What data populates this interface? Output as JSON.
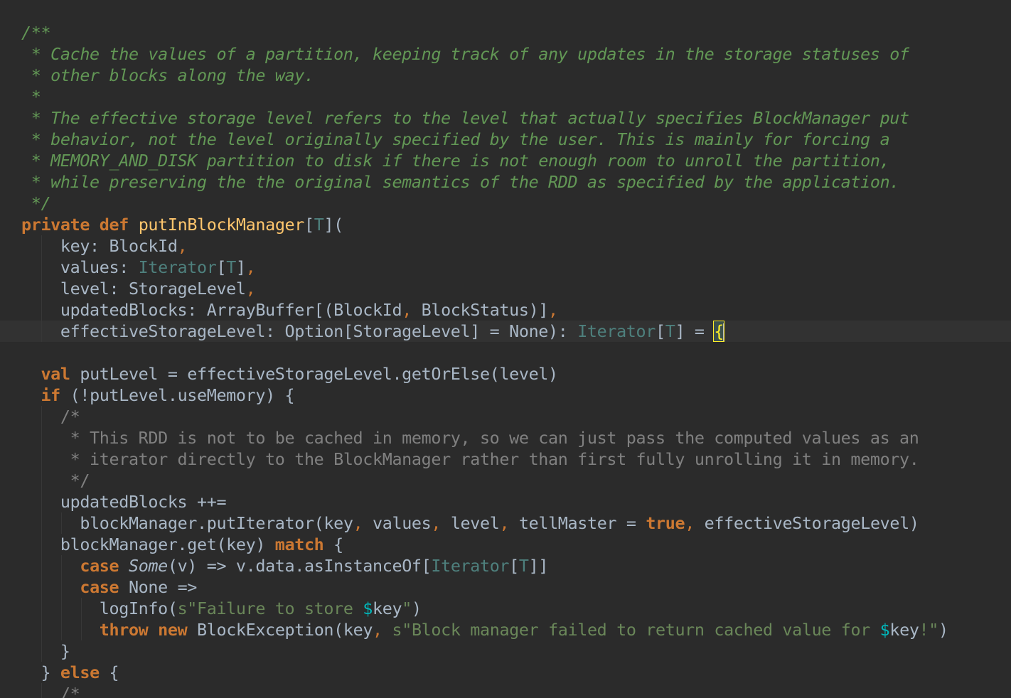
{
  "lines": [
    {
      "indent": 0,
      "tokens": [
        {
          "t": "/**",
          "c": "doc"
        }
      ]
    },
    {
      "indent": 0,
      "tokens": [
        {
          "t": " * Cache the values of a partition, keeping track of any updates in the storage statuses of",
          "c": "doc"
        }
      ]
    },
    {
      "indent": 0,
      "tokens": [
        {
          "t": " * other blocks along the way.",
          "c": "doc"
        }
      ]
    },
    {
      "indent": 0,
      "tokens": [
        {
          "t": " *",
          "c": "doc"
        }
      ]
    },
    {
      "indent": 0,
      "tokens": [
        {
          "t": " * The effective storage level refers to the level that actually specifies BlockManager put",
          "c": "doc"
        }
      ]
    },
    {
      "indent": 0,
      "tokens": [
        {
          "t": " * behavior, not the level originally specified by the user. This is mainly for forcing a",
          "c": "doc"
        }
      ]
    },
    {
      "indent": 0,
      "tokens": [
        {
          "t": " * MEMORY_AND_DISK partition to disk if there is not enough room to unroll the partition,",
          "c": "doc"
        }
      ]
    },
    {
      "indent": 0,
      "tokens": [
        {
          "t": " * while preserving the the original semantics of the RDD as specified by the application.",
          "c": "doc"
        }
      ]
    },
    {
      "indent": 0,
      "tokens": [
        {
          "t": " */",
          "c": "doc"
        }
      ]
    },
    {
      "indent": 0,
      "tokens": [
        {
          "t": "private",
          "c": "kw"
        },
        {
          "t": " ",
          "c": "id"
        },
        {
          "t": "def",
          "c": "kw"
        },
        {
          "t": " ",
          "c": "id"
        },
        {
          "t": "putInBlockManager",
          "c": "fn"
        },
        {
          "t": "[",
          "c": "punct"
        },
        {
          "t": "T",
          "c": "tparam"
        },
        {
          "t": "](",
          "c": "punct"
        }
      ]
    },
    {
      "indent": 2,
      "tokens": [
        {
          "t": "key: BlockId",
          "c": "id"
        },
        {
          "t": ",",
          "c": "comma"
        }
      ]
    },
    {
      "indent": 2,
      "tokens": [
        {
          "t": "values: ",
          "c": "id"
        },
        {
          "t": "Iterator",
          "c": "tparam"
        },
        {
          "t": "[",
          "c": "punct"
        },
        {
          "t": "T",
          "c": "tparam"
        },
        {
          "t": "]",
          "c": "punct"
        },
        {
          "t": ",",
          "c": "comma"
        }
      ]
    },
    {
      "indent": 2,
      "tokens": [
        {
          "t": "level: StorageLevel",
          "c": "id"
        },
        {
          "t": ",",
          "c": "comma"
        }
      ]
    },
    {
      "indent": 2,
      "tokens": [
        {
          "t": "updatedBlocks: ArrayBuffer[(BlockId",
          "c": "id"
        },
        {
          "t": ",",
          "c": "comma"
        },
        {
          "t": " BlockStatus)]",
          "c": "id"
        },
        {
          "t": ",",
          "c": "comma"
        }
      ]
    },
    {
      "indent": 2,
      "current": true,
      "tokens": [
        {
          "t": "effectiveStorageLevel: Option[StorageLevel] = None): ",
          "c": "id"
        },
        {
          "t": "Iterator",
          "c": "tparam"
        },
        {
          "t": "[",
          "c": "punct"
        },
        {
          "t": "T",
          "c": "tparam"
        },
        {
          "t": "] = ",
          "c": "punct"
        },
        {
          "t": "{",
          "c": "brace"
        },
        {
          "t": "",
          "c": "caret"
        }
      ]
    },
    {
      "indent": 0,
      "tokens": []
    },
    {
      "indent": 1,
      "tokens": [
        {
          "t": "val",
          "c": "kw"
        },
        {
          "t": " putLevel = effectiveStorageLevel.getOrElse(level)",
          "c": "id"
        }
      ]
    },
    {
      "indent": 1,
      "tokens": [
        {
          "t": "if",
          "c": "kw"
        },
        {
          "t": " (!putLevel.useMemory) {",
          "c": "id"
        }
      ]
    },
    {
      "indent": 2,
      "tokens": [
        {
          "t": "/*",
          "c": "comment"
        }
      ]
    },
    {
      "indent": 2,
      "tokens": [
        {
          "t": " * This RDD is not to be cached in memory, so we can just pass the computed values as an",
          "c": "comment"
        }
      ]
    },
    {
      "indent": 2,
      "tokens": [
        {
          "t": " * iterator directly to the BlockManager rather than first fully unrolling it in memory.",
          "c": "comment"
        }
      ]
    },
    {
      "indent": 2,
      "tokens": [
        {
          "t": " */",
          "c": "comment"
        }
      ]
    },
    {
      "indent": 2,
      "tokens": [
        {
          "t": "updatedBlocks ++=",
          "c": "id"
        }
      ]
    },
    {
      "indent": 3,
      "tokens": [
        {
          "t": "blockManager.putIterator(key",
          "c": "id"
        },
        {
          "t": ",",
          "c": "comma"
        },
        {
          "t": " values",
          "c": "id"
        },
        {
          "t": ",",
          "c": "comma"
        },
        {
          "t": " level",
          "c": "id"
        },
        {
          "t": ",",
          "c": "comma"
        },
        {
          "t": " tellMaster = ",
          "c": "id"
        },
        {
          "t": "true",
          "c": "kw"
        },
        {
          "t": ",",
          "c": "comma"
        },
        {
          "t": " effectiveStorageLevel)",
          "c": "id"
        }
      ]
    },
    {
      "indent": 2,
      "tokens": [
        {
          "t": "blockManager.get(key) ",
          "c": "id"
        },
        {
          "t": "match",
          "c": "kw"
        },
        {
          "t": " {",
          "c": "id"
        }
      ]
    },
    {
      "indent": 3,
      "tokens": [
        {
          "t": "case",
          "c": "kw"
        },
        {
          "t": " ",
          "c": "id"
        },
        {
          "t": "Some",
          "c": "objitalic"
        },
        {
          "t": "(v) => v.data.asInstanceOf[",
          "c": "id"
        },
        {
          "t": "Iterator",
          "c": "tparam"
        },
        {
          "t": "[",
          "c": "punct"
        },
        {
          "t": "T",
          "c": "tparam"
        },
        {
          "t": "]]",
          "c": "punct"
        }
      ]
    },
    {
      "indent": 3,
      "tokens": [
        {
          "t": "case",
          "c": "kw"
        },
        {
          "t": " None =>",
          "c": "id"
        }
      ]
    },
    {
      "indent": 4,
      "tokens": [
        {
          "t": "logInfo(",
          "c": "id"
        },
        {
          "t": "s\"Failure to store ",
          "c": "str"
        },
        {
          "t": "$",
          "c": "interp"
        },
        {
          "t": "key",
          "c": "id"
        },
        {
          "t": "\"",
          "c": "str"
        },
        {
          "t": ")",
          "c": "id"
        }
      ]
    },
    {
      "indent": 4,
      "tokens": [
        {
          "t": "throw",
          "c": "kw"
        },
        {
          "t": " ",
          "c": "id"
        },
        {
          "t": "new",
          "c": "kw"
        },
        {
          "t": " BlockException(key",
          "c": "id"
        },
        {
          "t": ",",
          "c": "comma"
        },
        {
          "t": " ",
          "c": "id"
        },
        {
          "t": "s\"Block manager failed to return cached value for ",
          "c": "str"
        },
        {
          "t": "$",
          "c": "interp"
        },
        {
          "t": "key",
          "c": "id"
        },
        {
          "t": "!\"",
          "c": "str"
        },
        {
          "t": ")",
          "c": "id"
        }
      ]
    },
    {
      "indent": 2,
      "tokens": [
        {
          "t": "}",
          "c": "id"
        }
      ]
    },
    {
      "indent": 1,
      "tokens": [
        {
          "t": "} ",
          "c": "id"
        },
        {
          "t": "else",
          "c": "kw"
        },
        {
          "t": " {",
          "c": "id"
        }
      ]
    },
    {
      "indent": 2,
      "tokens": [
        {
          "t": "/*",
          "c": "comment"
        }
      ]
    }
  ]
}
